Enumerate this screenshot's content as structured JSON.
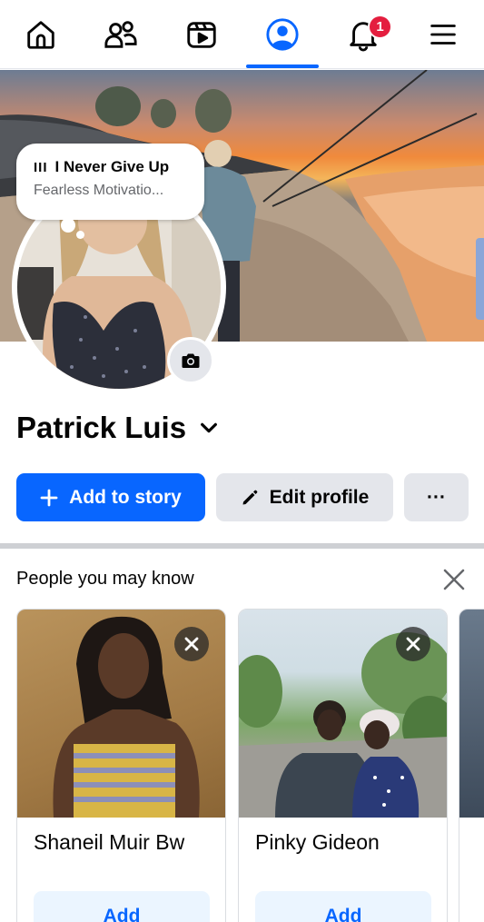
{
  "nav": {
    "items": [
      {
        "name": "home",
        "icon": "home-icon"
      },
      {
        "name": "friends",
        "icon": "friends-icon"
      },
      {
        "name": "video",
        "icon": "video-icon"
      },
      {
        "name": "profile",
        "icon": "profile-icon",
        "active": true
      },
      {
        "name": "notifications",
        "icon": "bell-icon"
      },
      {
        "name": "menu",
        "icon": "hamburger-icon"
      }
    ],
    "notification_badge": "1"
  },
  "note": {
    "bars": "III",
    "song_title": "I Never Give Up",
    "artist": "Fearless Motivatio..."
  },
  "profile": {
    "name": "Patrick Luis"
  },
  "actions": {
    "add_to_story": "Add to story",
    "edit_profile": "Edit profile",
    "more": "···"
  },
  "pymk": {
    "title": "People you may know",
    "cards": [
      {
        "name": "Shaneil Muir Bw",
        "button": "Add"
      },
      {
        "name": "Pinky Gideon",
        "button": "Add"
      }
    ]
  },
  "colors": {
    "accent": "#0866ff",
    "badge": "#e41e3f",
    "secondary_button": "#e4e6eb"
  }
}
